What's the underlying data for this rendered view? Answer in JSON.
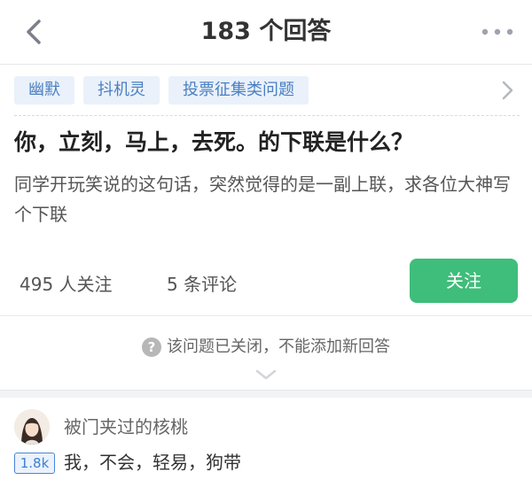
{
  "header": {
    "title": "183 个回答",
    "back_icon": "chevron-left-icon",
    "more_icon": "more-horizontal-icon"
  },
  "tags": [
    "幽默",
    "抖机灵",
    "投票征集类问题"
  ],
  "question": {
    "title": "你，立刻，马上，去死。的下联是什么？",
    "description": "同学开玩笑说的这句话，突然觉得的是一副上联，求各位大神写个下联"
  },
  "stats": {
    "followers": "495 人关注",
    "comments": "5 条评论",
    "follow_button": "关注"
  },
  "notice": {
    "icon": "?",
    "text": "该问题已关闭，不能添加新回答"
  },
  "answer": {
    "author": "被门夹过的核桃",
    "votes": "1.8k",
    "text": "我，不会，轻易，狗带"
  },
  "colors": {
    "accent_green": "#3fbd7a",
    "tag_bg": "#eaf1fa",
    "tag_text": "#4a7fc1",
    "vote_blue": "#3f7ed5"
  }
}
